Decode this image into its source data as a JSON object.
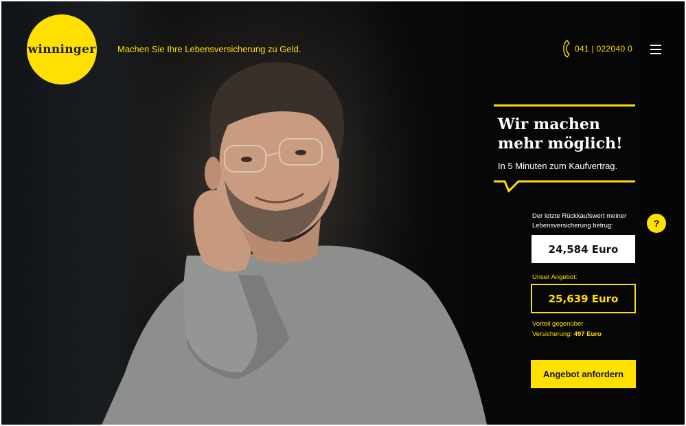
{
  "brand": {
    "logo_text": "winninger",
    "tagline": "Machen Sie Ihre Lebensversicherung zu Geld."
  },
  "header": {
    "phone": "041 | 022040 0",
    "phone_icon": "phone-icon",
    "menu_icon": "hamburger-menu-icon"
  },
  "hero": {
    "headline_line1": "Wir machen",
    "headline_line2": "mehr möglich!",
    "subline": "In 5 Minuten zum Kaufvertrag."
  },
  "calculator": {
    "surrender_label": "Der letzte Rückkaufswert meiner Lebensversicherung betrug:",
    "help_label": "?",
    "surrender_value": "24,584 Euro",
    "offer_label": "Unser Angebot:",
    "offer_value": "25,639 Euro",
    "advantage_line1": "Vorteil gegenüber",
    "advantage_prefix": "Versicherung:",
    "advantage_value": "497 Euro",
    "cta_label": "Angebot anfordern"
  },
  "colors": {
    "accent": "#ffe000",
    "background": "#0b0b0b",
    "text_light": "#ffffff"
  }
}
